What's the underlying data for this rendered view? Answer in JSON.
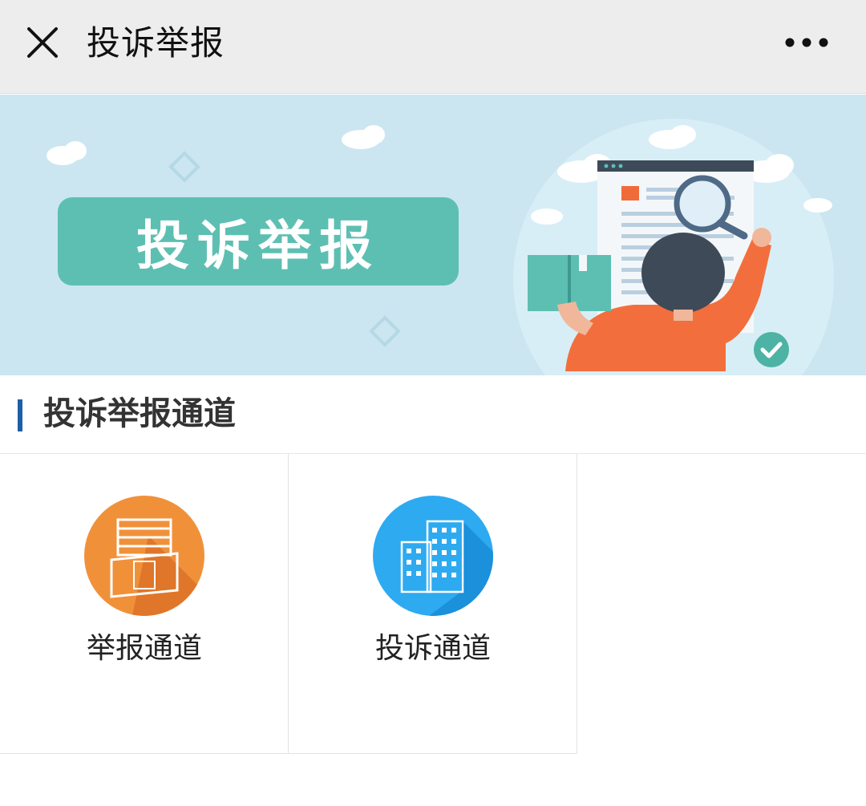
{
  "nav": {
    "title": "投诉举报",
    "close_icon": "close-icon",
    "more_icon": "more-dots-icon"
  },
  "banner": {
    "title": "投诉举报",
    "colors": {
      "background": "#cbe6f0",
      "title_box": "#5dbfb2"
    }
  },
  "section": {
    "title": "投诉举报通道",
    "accent_color": "#1e5fa8"
  },
  "channels": [
    {
      "label": "举报通道",
      "icon": "building-orange-icon",
      "color": "#f0913a"
    },
    {
      "label": "投诉通道",
      "icon": "building-blue-icon",
      "color": "#2eaaf0"
    }
  ]
}
